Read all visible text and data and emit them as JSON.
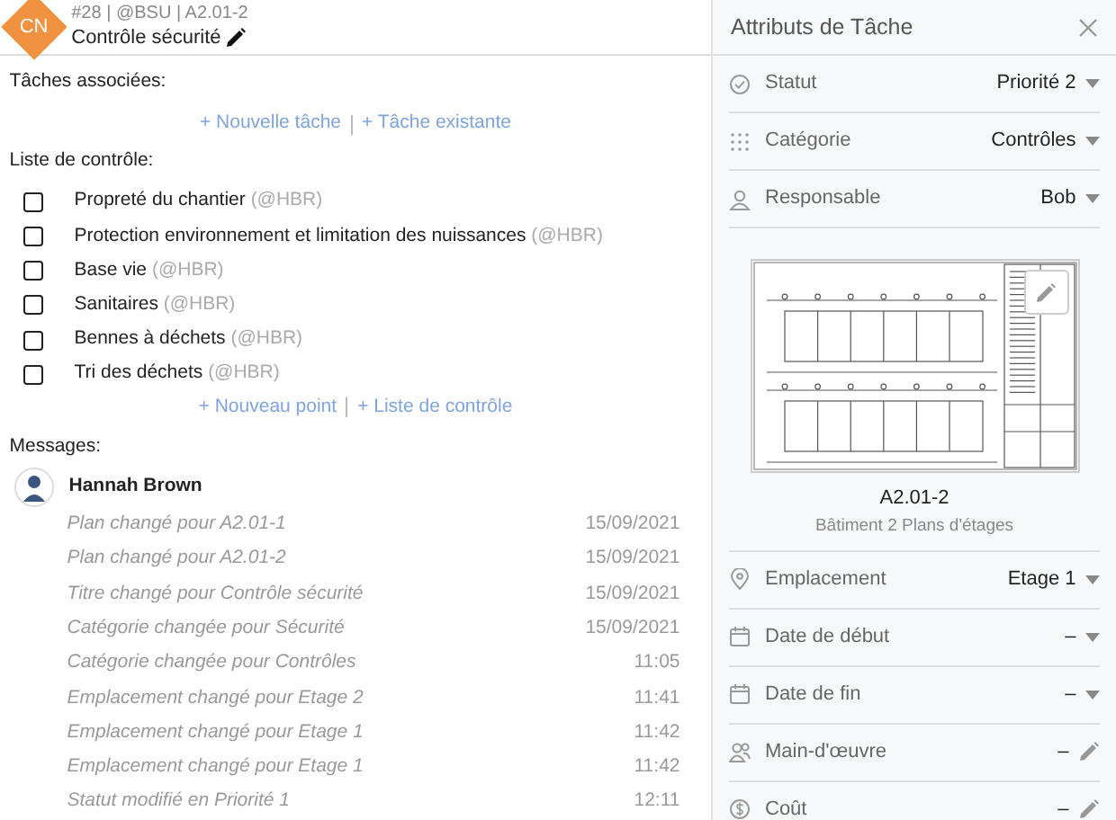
{
  "header": {
    "avatar": "CN",
    "meta": "#28 | @BSU | A2.01-2",
    "title": "Contrôle sécurité"
  },
  "related_tasks": {
    "label": "Tâches associées:",
    "links": [
      "+ Nouvelle tâche",
      "+ Tâche existante"
    ]
  },
  "checklist": {
    "label": "Liste de contrôle:",
    "items": [
      {
        "text": "Propreté du chantier",
        "assignee": "(@HBR)",
        "checked": false
      },
      {
        "text": "Protection environnement et limitation des nuissances",
        "assignee": "(@HBR)",
        "checked": false
      },
      {
        "text": "Base vie",
        "assignee": "(@HBR)",
        "checked": false
      },
      {
        "text": "Sanitaires",
        "assignee": "(@HBR)",
        "checked": false
      },
      {
        "text": "Bennes à déchets",
        "assignee": "(@HBR)",
        "checked": false
      },
      {
        "text": "Tri des déchets",
        "assignee": "(@HBR)",
        "checked": false
      }
    ],
    "links": [
      "+ Nouveau point",
      "+ Liste de contrôle"
    ]
  },
  "messages": {
    "label": "Messages:",
    "author": "Hannah Brown",
    "entries": [
      {
        "text": "Plan changé pour A2.01-1",
        "time": "15/09/2021"
      },
      {
        "text": "Plan changé pour A2.01-2",
        "time": "15/09/2021"
      },
      {
        "text": "Titre changé pour Contrôle sécurité",
        "time": "15/09/2021"
      },
      {
        "text": "Catégorie changée pour Sécurité",
        "time": "15/09/2021"
      },
      {
        "text": "Catégorie changée pour Contrôles",
        "time": "11:05"
      },
      {
        "text": "Emplacement changé pour Etage 2",
        "time": "11:41"
      },
      {
        "text": "Emplacement changé pour Etage 1",
        "time": "11:42"
      },
      {
        "text": "Emplacement changé pour Etage 1",
        "time": "11:42"
      },
      {
        "text": "Statut modifié en Priorité 1",
        "time": "12:11"
      }
    ]
  },
  "panel": {
    "title": "Attributs de Tâche",
    "attributes_top": [
      {
        "label": "Statut",
        "value": "Priorité 2",
        "kind": "dropdown"
      },
      {
        "label": "Catégorie",
        "value": "Contrôles",
        "kind": "dropdown"
      },
      {
        "label": "Responsable",
        "value": "Bob",
        "kind": "dropdown"
      }
    ],
    "plan": {
      "code": "A2.01-2",
      "description": "Bâtiment 2 Plans d'étages"
    },
    "attributes_bottom": [
      {
        "label": "Emplacement",
        "value": "Etage 1",
        "kind": "dropdown"
      },
      {
        "label": "Date de début",
        "value": "–",
        "kind": "dropdown"
      },
      {
        "label": "Date de fin",
        "value": "–",
        "kind": "dropdown"
      },
      {
        "label": "Main-d'œuvre",
        "value": "–",
        "kind": "edit"
      },
      {
        "label": "Coût",
        "value": "–",
        "kind": "edit"
      }
    ]
  }
}
